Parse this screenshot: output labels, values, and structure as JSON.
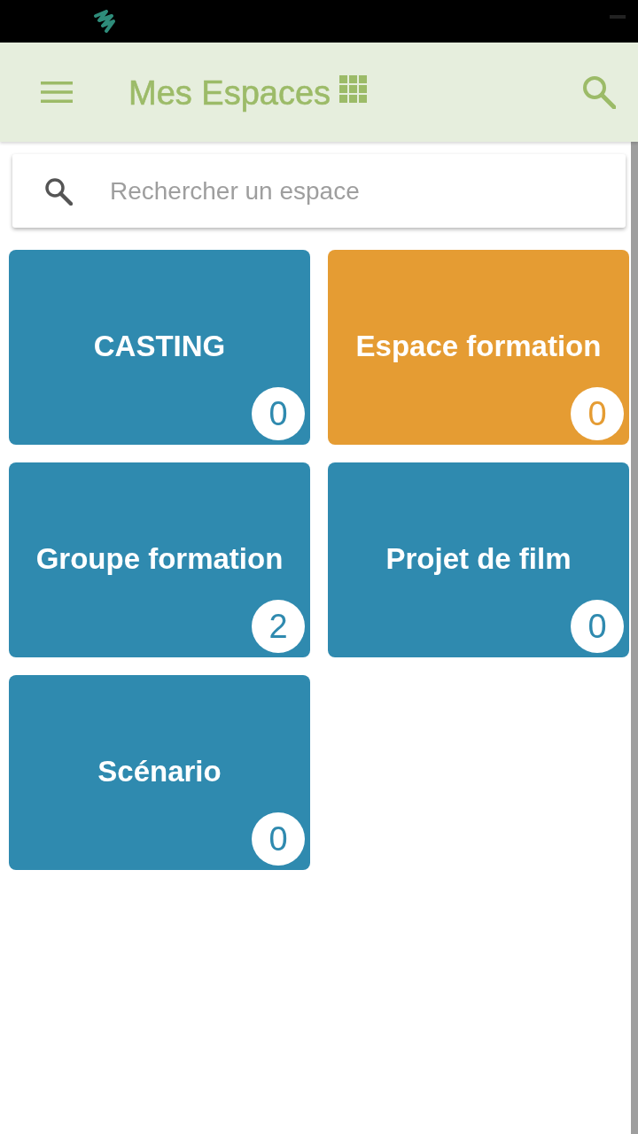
{
  "app_bar": {
    "title": "Mes Espaces"
  },
  "search": {
    "placeholder": "Rechercher un espace"
  },
  "spaces": [
    {
      "name": "CASTING",
      "count": "0",
      "color": "#2f8aaf"
    },
    {
      "name": "Espace formation",
      "count": "0",
      "color": "#e59c33"
    },
    {
      "name": "Groupe formation",
      "count": "2",
      "color": "#2f8aaf"
    },
    {
      "name": "Projet de film",
      "count": "0",
      "color": "#2f8aaf"
    },
    {
      "name": "Scénario",
      "count": "0",
      "color": "#2f8aaf"
    }
  ]
}
